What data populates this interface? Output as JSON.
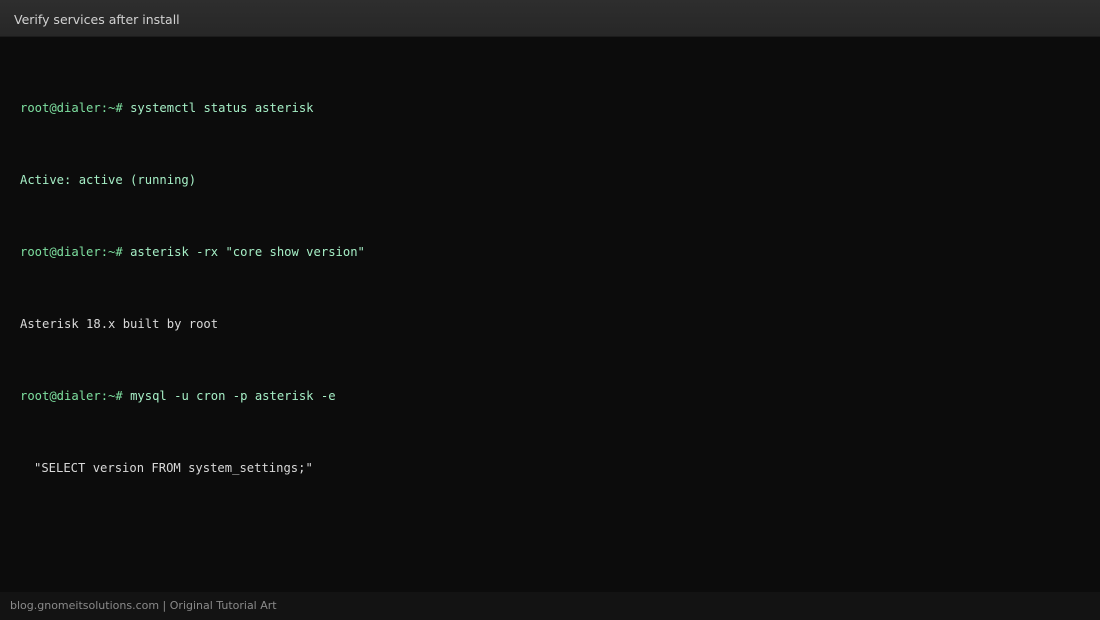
{
  "window": {
    "title": "Verify services after install"
  },
  "terminal": {
    "lines": [
      {
        "prompt": "root@dialer:~#",
        "command": "systemctl status asterisk"
      },
      {
        "output": "Active: active (running)"
      },
      {
        "prompt": "root@dialer:~#",
        "command": "asterisk -rx \"core show version\""
      },
      {
        "output": "Asterisk 18.x built by root"
      },
      {
        "prompt": "root@dialer:~#",
        "command": "mysql -u cron -p asterisk -e"
      },
      {
        "output": "\"SELECT version FROM system_settings;\""
      }
    ]
  },
  "footer": {
    "credit": "blog.gnomeitsolutions.com | Original Tutorial Art"
  },
  "colors": {
    "background": "#0c0c0c",
    "prompt": "#7ee0a0",
    "command": "#a6efc6",
    "output": "#d9d9d9"
  }
}
